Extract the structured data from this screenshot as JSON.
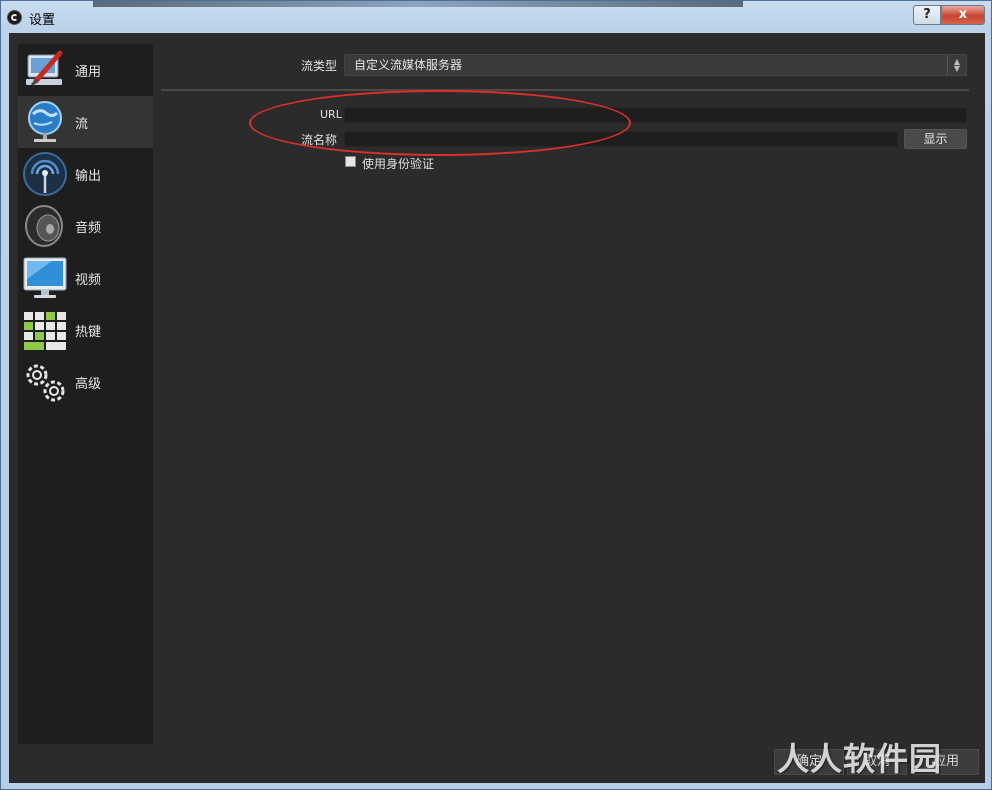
{
  "window": {
    "title": "设置",
    "help_label": "?",
    "close_label": "x"
  },
  "sidebar": {
    "items": [
      {
        "label": "通用",
        "icon": "general-settings-icon"
      },
      {
        "label": "流",
        "icon": "stream-globe-icon"
      },
      {
        "label": "输出",
        "icon": "output-antenna-icon"
      },
      {
        "label": "音频",
        "icon": "audio-speaker-icon"
      },
      {
        "label": "视频",
        "icon": "video-monitor-icon"
      },
      {
        "label": "热键",
        "icon": "hotkeys-keyboard-icon"
      },
      {
        "label": "高级",
        "icon": "advanced-gears-icon"
      }
    ],
    "active_index": 1
  },
  "stream": {
    "type_label": "流类型",
    "type_value": "自定义流媒体服务器",
    "url_label": "URL",
    "url_value": "",
    "key_label": "流名称",
    "key_value": "",
    "show_button": "显示",
    "auth_label": "使用身份验证",
    "auth_checked": false
  },
  "footer": {
    "ok": "确定",
    "cancel": "取消",
    "apply": "应用"
  },
  "watermark": "人人软件园",
  "annotation": {
    "color": "#d8302b"
  }
}
